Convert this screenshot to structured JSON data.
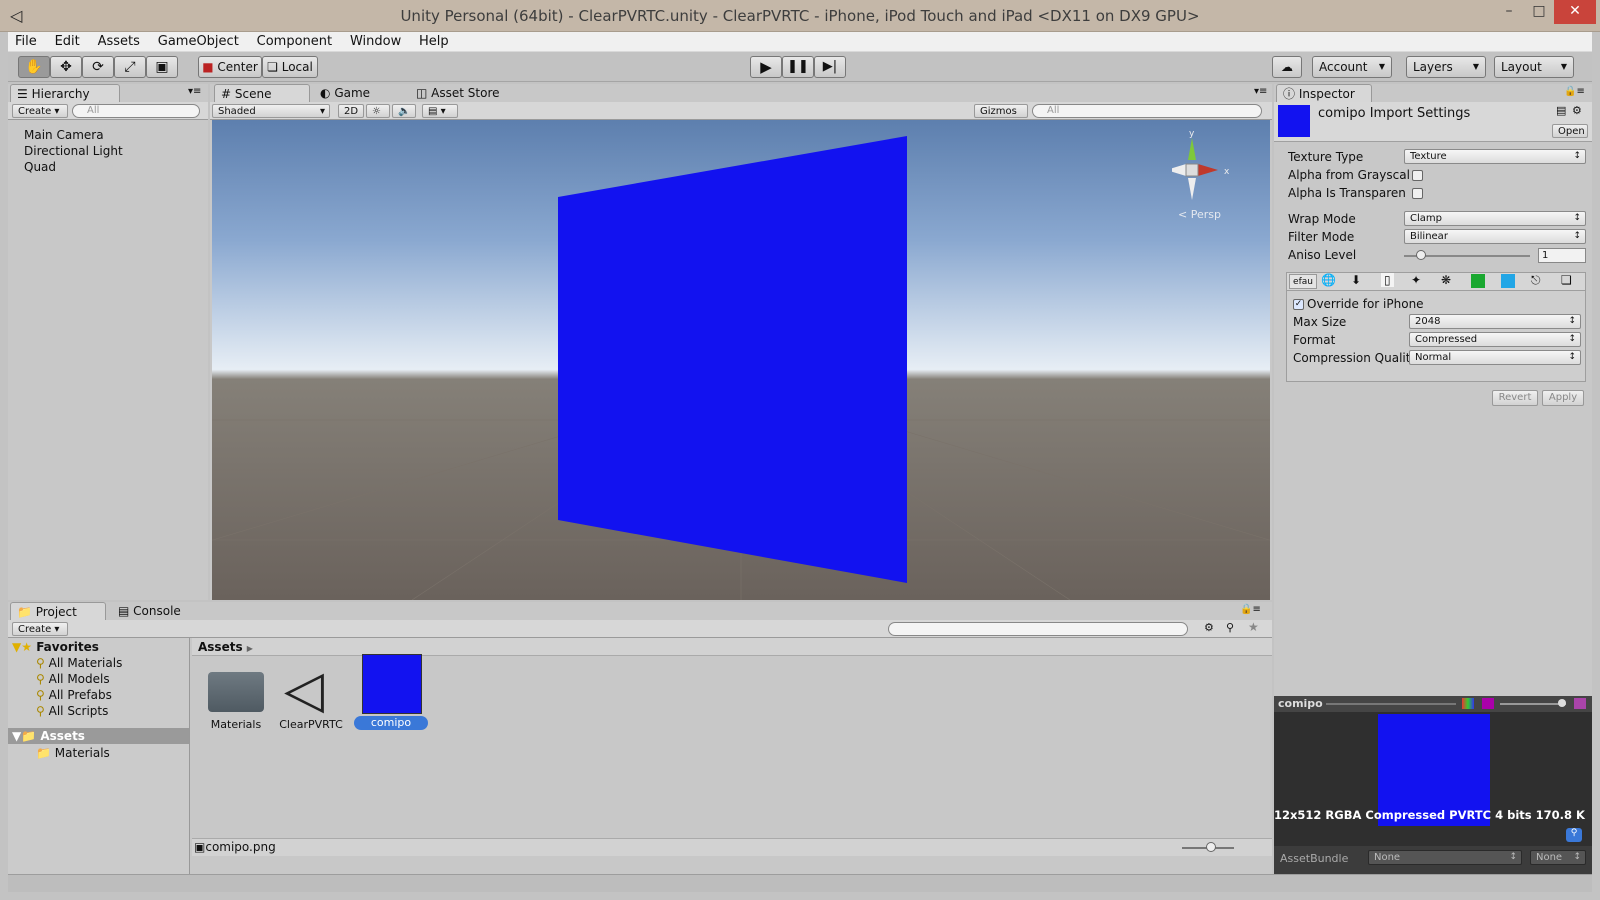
{
  "window": {
    "title": "Unity Personal (64bit) - ClearPVRTC.unity - ClearPVRTC - iPhone, iPod Touch and iPad <DX11 on DX9 GPU>",
    "minimize": "–",
    "maximize": "□",
    "close": "✕"
  },
  "menu": [
    "File",
    "Edit",
    "Assets",
    "GameObject",
    "Component",
    "Window",
    "Help"
  ],
  "toolbar": {
    "pivot": "Center",
    "space": "Local",
    "account": "Account",
    "layers": "Layers",
    "layout": "Layout"
  },
  "hierarchy": {
    "tab": "Hierarchy",
    "create": "Create",
    "search_placeholder": "All",
    "items": [
      "Main Camera",
      "Directional Light",
      "Quad"
    ]
  },
  "scene": {
    "tabs": [
      "Scene",
      "Game",
      "Asset Store"
    ],
    "shading": "Shaded",
    "mode_2d": "2D",
    "gizmos": "Gizmos",
    "search_placeholder": "All",
    "persp": "< Persp"
  },
  "inspector": {
    "tab": "Inspector",
    "asset_title": "comipo Import Settings",
    "open": "Open",
    "texture_type_label": "Texture Type",
    "texture_type": "Texture",
    "alpha_gray": "Alpha from Grayscal",
    "alpha_trans": "Alpha Is Transparen",
    "wrap_label": "Wrap Mode",
    "wrap": "Clamp",
    "filter_label": "Filter Mode",
    "filter": "Bilinear",
    "aniso_label": "Aniso Level",
    "aniso": "1",
    "aniso_fraction": 0.1,
    "platform_default": "efau",
    "override": "Override for iPhone",
    "maxsize_label": "Max Size",
    "maxsize": "2048",
    "format_label": "Format",
    "format": "Compressed",
    "quality_label": "Compression Quality",
    "quality": "Normal",
    "revert": "Revert",
    "apply": "Apply",
    "preview_name": "comipo",
    "preview_info": "12x512  RGBA Compressed PVRTC 4 bits   170.8 K",
    "assetbundle_label": "AssetBundle",
    "assetbundle": "None",
    "variant": "None",
    "preview_color": "#1212f0"
  },
  "project": {
    "tabs": [
      "Project",
      "Console"
    ],
    "create": "Create",
    "favorites": "Favorites",
    "fav_items": [
      "All Materials",
      "All Models",
      "All Prefabs",
      "All Scripts"
    ],
    "assets_root": "Assets",
    "assets_children": [
      "Materials"
    ],
    "breadcrumb": "Assets",
    "files": [
      "Materials",
      "ClearPVRTC",
      "comipo"
    ],
    "selected_file": "comipo.png"
  },
  "colors": {
    "quad": "#1212f0",
    "selection": "#3a78d8"
  }
}
